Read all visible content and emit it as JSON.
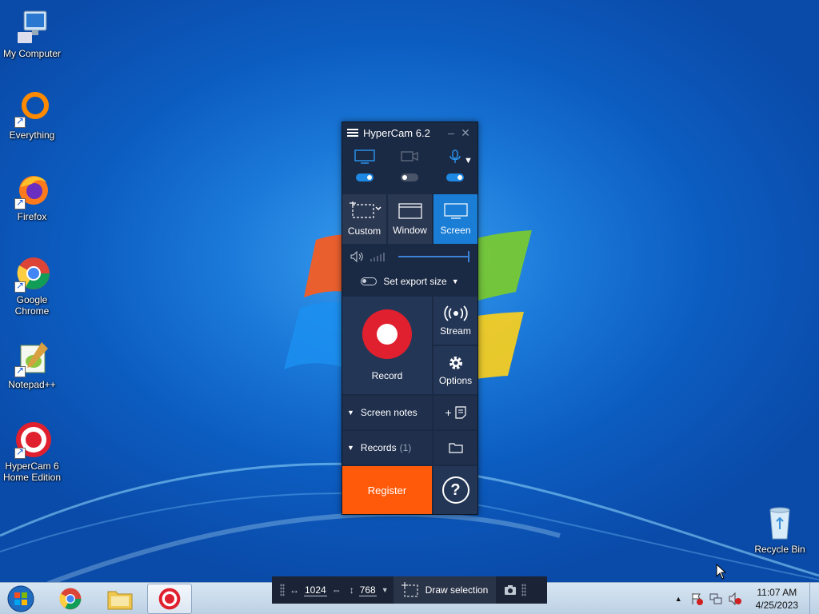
{
  "desktop": {
    "icons": [
      {
        "label": "My Computer",
        "icon": "computer-icon"
      },
      {
        "label": "Everything",
        "icon": "everything-icon"
      },
      {
        "label": "Firefox",
        "icon": "firefox-icon"
      },
      {
        "label": "Google Chrome",
        "icon": "chrome-icon"
      },
      {
        "label": "Notepad++",
        "icon": "notepadpp-icon"
      },
      {
        "label": "HyperCam 6 Home Edition",
        "icon": "hypercam-icon"
      },
      {
        "label": "Recycle Bin",
        "icon": "recycle-bin-icon"
      }
    ]
  },
  "hypercam": {
    "title": "HyperCam 6.2",
    "sources": {
      "screen": {
        "icon": "monitor-icon",
        "enabled": true
      },
      "webcam": {
        "icon": "webcam-icon",
        "enabled": false
      },
      "microphone": {
        "icon": "microphone-icon",
        "enabled": true
      }
    },
    "modes": [
      {
        "label": "Custom",
        "icon": "custom-area-icon",
        "active": false
      },
      {
        "label": "Window",
        "icon": "window-icon",
        "active": false
      },
      {
        "label": "Screen",
        "icon": "screen-icon",
        "active": true
      }
    ],
    "volume": 1.0,
    "export_size_label": "Set export size",
    "record_label": "Record",
    "stream_label": "Stream",
    "options_label": "Options",
    "screen_notes_label": "Screen notes",
    "records_label": "Records",
    "records_count": "(1)",
    "register_label": "Register",
    "help_symbol": "?",
    "colors": {
      "accent": "#1a7ed6",
      "record": "#e0202e",
      "register": "#ff5a0a",
      "panel": "#1b2a44"
    }
  },
  "selection_bar": {
    "width_value": "1024",
    "height_value": "768",
    "draw_label": "Draw selection"
  },
  "taskbar": {
    "time": "11:07 AM",
    "date": "4/25/2023",
    "buttons": [
      "start-orb",
      "chrome",
      "file-explorer",
      "hypercam"
    ]
  }
}
